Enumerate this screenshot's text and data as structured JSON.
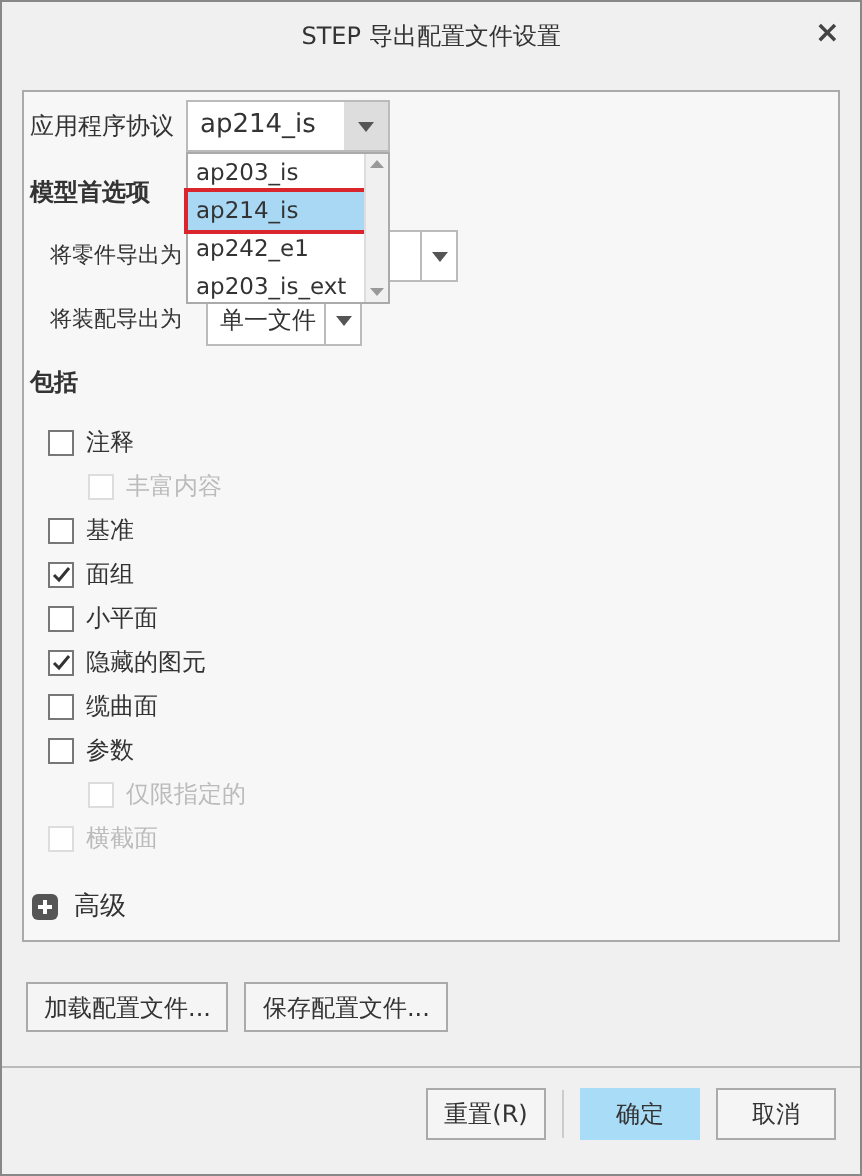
{
  "window": {
    "title": "STEP 导出配置文件设置",
    "close": "×"
  },
  "protocol": {
    "label": "应用程序协议",
    "value": "ap214_is",
    "expanded": true,
    "options": [
      {
        "label": "ap203_is",
        "selected": false
      },
      {
        "label": "ap214_is",
        "selected": true
      },
      {
        "label": "ap242_e1",
        "selected": false
      },
      {
        "label": "ap203_is_ext",
        "selected": false
      }
    ]
  },
  "model_prefs": {
    "heading": "模型首选项",
    "rows": [
      {
        "label": "将零件导出为"
      },
      {
        "label": "将装配导出为",
        "value": "单一文件"
      }
    ]
  },
  "include": {
    "heading": "包括",
    "items": [
      {
        "label": "注释",
        "checked": false,
        "disabled": false,
        "children": [
          {
            "label": "丰富内容",
            "checked": false,
            "disabled": true
          }
        ]
      },
      {
        "label": "基准",
        "checked": false,
        "disabled": false
      },
      {
        "label": "面组",
        "checked": true,
        "disabled": false
      },
      {
        "label": "小平面",
        "checked": false,
        "disabled": false
      },
      {
        "label": "隐藏的图元",
        "checked": true,
        "disabled": false
      },
      {
        "label": "缆曲面",
        "checked": false,
        "disabled": false
      },
      {
        "label": "参数",
        "checked": false,
        "disabled": false,
        "children": [
          {
            "label": "仅限指定的",
            "checked": false,
            "disabled": true
          }
        ]
      },
      {
        "label": "横截面",
        "checked": false,
        "disabled": true
      }
    ]
  },
  "advanced": {
    "label": "高级",
    "expanded": false
  },
  "config_buttons": [
    "加载配置文件...",
    "保存配置文件..."
  ],
  "buttons": [
    {
      "label": "重置(R)",
      "selected": false
    },
    {
      "label": "确定",
      "selected": true
    },
    {
      "label": "取消",
      "selected": false
    }
  ]
}
